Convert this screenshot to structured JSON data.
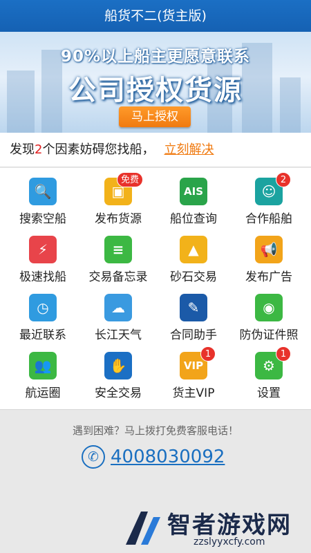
{
  "header": {
    "title": "船货不二(货主版)"
  },
  "banner": {
    "line1": "90%以上船主更愿意联系",
    "line2": "公司授权货源",
    "button": "马上授权"
  },
  "notice": {
    "prefix": "发现",
    "count": "2",
    "suffix": "个因素妨碍您找船，",
    "link": "立刻解决"
  },
  "grid": [
    {
      "label": "搜索空船",
      "icon": "search-icon",
      "color": "#2f9be0",
      "glyph": "🔍"
    },
    {
      "label": "发布货源",
      "icon": "cargo-icon",
      "color": "#f2b21a",
      "glyph": "▣",
      "badge": "免费"
    },
    {
      "label": "船位查询",
      "icon": "ais-icon",
      "color": "#2aa44a",
      "glyph": "AIS"
    },
    {
      "label": "合作船舶",
      "icon": "captain-icon",
      "color": "#1ba3a0",
      "glyph": "☺",
      "badge": "2"
    },
    {
      "label": "极速找船",
      "icon": "lightning-icon",
      "color": "#e8444a",
      "glyph": "⚡"
    },
    {
      "label": "交易备忘录",
      "icon": "memo-icon",
      "color": "#3cb843",
      "glyph": "≡"
    },
    {
      "label": "砂石交易",
      "icon": "sand-icon",
      "color": "#f2b21a",
      "glyph": "▲"
    },
    {
      "label": "发布广告",
      "icon": "megaphone-icon",
      "color": "#f2a41a",
      "glyph": "📢"
    },
    {
      "label": "最近联系",
      "icon": "clock-icon",
      "color": "#2f9be0",
      "glyph": "◷"
    },
    {
      "label": "长江天气",
      "icon": "weather-icon",
      "color": "#3a9ae0",
      "glyph": "☁"
    },
    {
      "label": "合同助手",
      "icon": "contract-icon",
      "color": "#1b5aa8",
      "glyph": "✎"
    },
    {
      "label": "防伪证件照",
      "icon": "camera-icon",
      "color": "#3cb843",
      "glyph": "◉"
    },
    {
      "label": "航运圈",
      "icon": "group-icon",
      "color": "#3cb843",
      "glyph": "👥"
    },
    {
      "label": "安全交易",
      "icon": "handshake-icon",
      "color": "#1b6fc4",
      "glyph": "✋"
    },
    {
      "label": "货主VIP",
      "icon": "vip-icon",
      "color": "#f2a41a",
      "glyph": "VIP",
      "badge": "1"
    },
    {
      "label": "设置",
      "icon": "gear-icon",
      "color": "#3cb843",
      "glyph": "⚙",
      "badge": "1"
    }
  ],
  "help": {
    "text": "遇到困难？马上拨打免费客服电话！",
    "phone": "4008030092"
  },
  "watermark": {
    "name": "智者游戏网",
    "url": "zzslyyxcfy.com"
  }
}
